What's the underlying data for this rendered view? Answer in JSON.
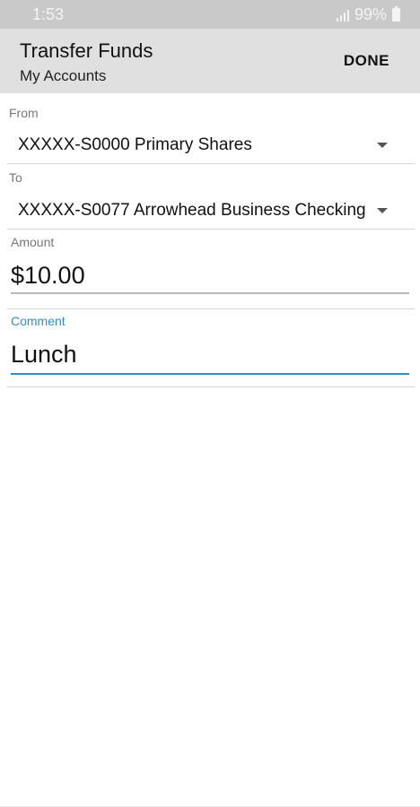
{
  "status_bar": {
    "time": "1:53",
    "battery": "99%"
  },
  "app_bar": {
    "title": "Transfer Funds",
    "subtitle": "My Accounts",
    "done_label": "DONE"
  },
  "form": {
    "from": {
      "label": "From",
      "value": "XXXXX-S0000 Primary Shares"
    },
    "to": {
      "label": "To",
      "value": "XXXXX-S0077 Arrowhead Business Checking"
    },
    "amount": {
      "label": "Amount",
      "value": "$10.00"
    },
    "comment": {
      "label": "Comment",
      "value": "Lunch"
    }
  },
  "colors": {
    "accent": "#2f8fc2",
    "app_bar_bg": "#e0e0e0",
    "status_bar_bg": "#c9c9c9"
  }
}
